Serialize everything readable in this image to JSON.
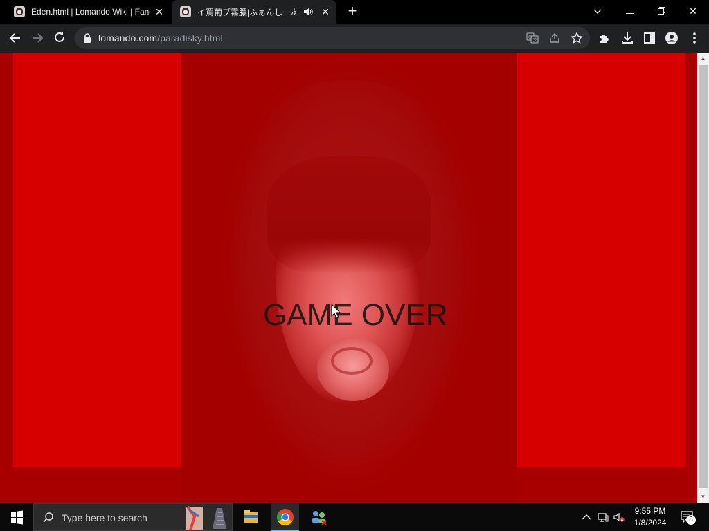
{
  "browser": {
    "tabs": [
      {
        "title": "Eden.html | Lomando Wiki | Fandom",
        "active": false
      },
      {
        "title": "イ罵葡ブ霧膿|ふぁんしーあいら/ハ",
        "active": true,
        "audio": true
      }
    ],
    "address": {
      "domain": "lomando.com",
      "path": "/paradisky.html"
    }
  },
  "page": {
    "overlay_text": "GAME OVER",
    "colors": {
      "background": "#a80000",
      "side_panels": "#d60000"
    }
  },
  "taskbar": {
    "search_placeholder": "Type here to search",
    "clock": {
      "time": "9:55 PM",
      "date": "1/8/2024"
    },
    "notification_count": "8"
  }
}
